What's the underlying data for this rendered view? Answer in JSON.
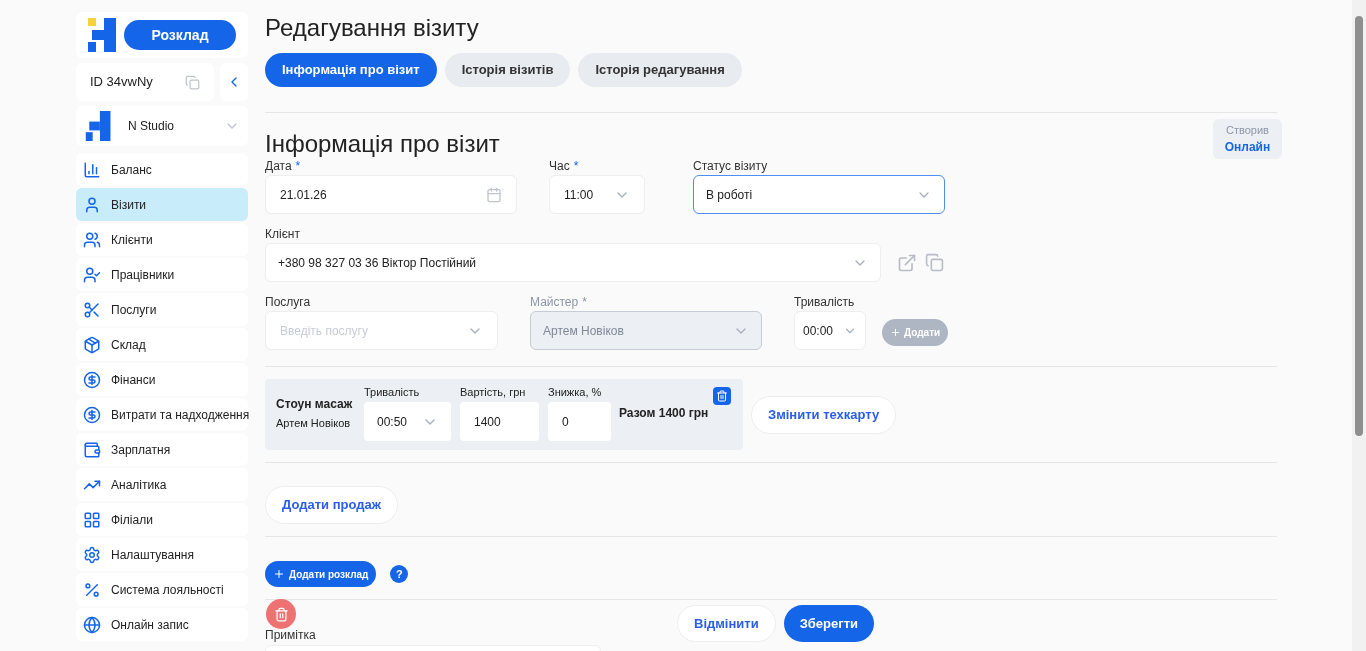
{
  "sidebar": {
    "schedule_button": "Розклад",
    "account_id": "ID 34vwNy",
    "studio": "N Studio",
    "items": [
      {
        "label": "Баланс",
        "selected": false
      },
      {
        "label": "Візити",
        "selected": true
      },
      {
        "label": "Клієнти",
        "selected": false
      },
      {
        "label": "Працівники",
        "selected": false
      },
      {
        "label": "Послуги",
        "selected": false
      },
      {
        "label": "Склад",
        "selected": false
      },
      {
        "label": "Фінанси",
        "selected": false
      },
      {
        "label": "Витрати та надходження",
        "selected": false
      },
      {
        "label": "Зарплатня",
        "selected": false
      },
      {
        "label": "Аналітика",
        "selected": false
      },
      {
        "label": "Філіали",
        "selected": false
      },
      {
        "label": "Налаштування",
        "selected": false
      },
      {
        "label": "Система лояльності",
        "selected": false
      },
      {
        "label": "Онлайн запис",
        "selected": false
      }
    ]
  },
  "page_title": "Редагування візиту",
  "tabs": [
    {
      "label": "Інформація про візит",
      "selected": true
    },
    {
      "label": "Історія візитів",
      "selected": false
    },
    {
      "label": "Історія редагування",
      "selected": false
    }
  ],
  "section_title": "Інформація про візит",
  "created_by": {
    "label": "Створив",
    "value": "Онлайн"
  },
  "date": {
    "label": "Дата",
    "required_mark": "*",
    "value": "21.01.26"
  },
  "time": {
    "label": "Час",
    "required_mark": "*",
    "value": "11:00"
  },
  "status": {
    "label": "Статус візиту",
    "value": "В роботі",
    "focused": true
  },
  "client": {
    "label": "Клієнт",
    "value": "+380 98 327 03 36 Віктор Постійний"
  },
  "service": {
    "label": "Послуга",
    "placeholder": "Введіть послугу"
  },
  "master": {
    "label": "Майстер",
    "required_mark": "*",
    "value": "Артем Новіков",
    "disabled": true
  },
  "duration": {
    "label": "Тривалість",
    "value": "00:00"
  },
  "add_button": {
    "label": "Додати",
    "disabled": true
  },
  "service_rows": [
    {
      "name": "Стоун масаж",
      "master": "Артем Новіков",
      "duration_label": "Тривалість",
      "duration": "00:50",
      "price_label": "Вартість, грн",
      "price": "1400",
      "discount_label": "Знижка, %",
      "discount": "0",
      "total": "Разом 1400 грн"
    }
  ],
  "change_techcard": "Змінити техкарту",
  "add_sale": "Додати продаж",
  "add_schedule": "Додати розклад",
  "help": "?",
  "note_label": "Примітка",
  "cancel": "Відмінити",
  "save": "Зберегти"
}
